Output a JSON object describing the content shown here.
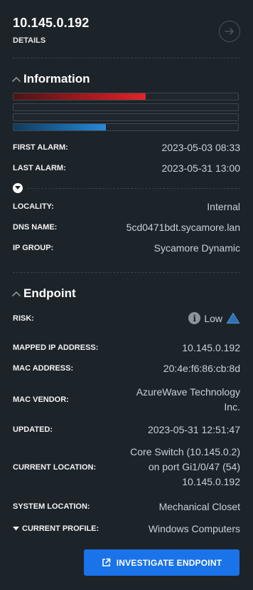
{
  "header": {
    "title": "10.145.0.192",
    "subtitle": "DETAILS",
    "go_icon": "arrow-right-circle-icon"
  },
  "information": {
    "heading": "Information",
    "bars": [
      {
        "color": "#e0242a",
        "fill": 0.59
      },
      {
        "color": "#2a8ad6",
        "fill": 0
      },
      {
        "color": "#2a8ad6",
        "fill": 0
      },
      {
        "color": "#2a8ad6",
        "fill": 0.41
      }
    ],
    "first_alarm_label": "FIRST ALARM:",
    "first_alarm": "2023-05-03 08:33",
    "last_alarm_label": "LAST ALARM:",
    "last_alarm": "2023-05-31 13:00",
    "locality_label": "LOCALITY:",
    "locality": "Internal",
    "dns_label": "DNS NAME:",
    "dns": "5cd0471bdt.sycamore.lan",
    "ip_group_label": "IP GROUP:",
    "ip_group": "Sycamore Dynamic"
  },
  "endpoint": {
    "heading": "Endpoint",
    "risk_label": "RISK:",
    "risk": "Low",
    "mapped_ip_label": "MAPPED IP ADDRESS:",
    "mapped_ip": "10.145.0.192",
    "mac_label": "MAC ADDRESS:",
    "mac": "20:4e:f6:86:cb:8d",
    "vendor_label": "MAC VENDOR:",
    "vendor_line1": "AzureWave Technology",
    "vendor_line2": "Inc.",
    "updated_label": "UPDATED:",
    "updated": "2023-05-31 12:51:47",
    "current_location_label": "CURRENT LOCATION:",
    "current_location_line1": "Core Switch (10.145.0.2)",
    "current_location_line2": "on port Gi1/0/47 (54)",
    "current_location_line3": "10.145.0.192",
    "system_location_label": "SYSTEM LOCATION:",
    "system_location": "Mechanical Closet",
    "current_profile_label": "CURRENT PROFILE:",
    "current_profile": "Windows Computers"
  },
  "actions": {
    "investigate_label": "INVESTIGATE ENDPOINT"
  },
  "colors": {
    "background": "#1c2329",
    "accent": "#1a73e8",
    "risk_low": "#3a7bc8"
  }
}
